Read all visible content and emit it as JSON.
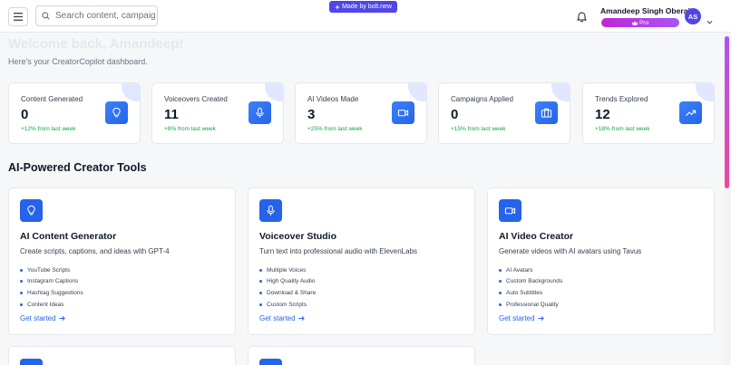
{
  "header": {
    "search_placeholder": "Search content, campaign",
    "bolt_badge": "Made by bolt.new",
    "user_name": "Amandeep Singh Oberai",
    "plan_badge": "Pro",
    "avatar_initials": "AS"
  },
  "welcome": {
    "title": "Welcome back, Amandeep!",
    "subtitle": "Here's your CreatorCopilot dashboard."
  },
  "stats": [
    {
      "title": "Content Generated",
      "value": "0",
      "change": "+12% from last week",
      "icon": "lightbulb-icon"
    },
    {
      "title": "Voiceovers Created",
      "value": "11",
      "change": "+8% from last week",
      "icon": "microphone-icon"
    },
    {
      "title": "AI Videos Made",
      "value": "3",
      "change": "+25% from last week",
      "icon": "video-icon"
    },
    {
      "title": "Campaigns Applied",
      "value": "0",
      "change": "+15% from last week",
      "icon": "briefcase-icon"
    },
    {
      "title": "Trends Explored",
      "value": "12",
      "change": "+18% from last week",
      "icon": "trending-up-icon"
    }
  ],
  "tools_section": {
    "title": "AI-Powered Creator Tools",
    "tools": [
      {
        "title": "AI Content Generator",
        "description": "Create scripts, captions, and ideas with GPT-4",
        "icon": "lightbulb-icon",
        "features": [
          "YouTube Scripts",
          "Instagram Captions",
          "Hashtag Suggestions",
          "Content Ideas"
        ],
        "link": "Get started"
      },
      {
        "title": "Voiceover Studio",
        "description": "Turn text into professional audio with ElevenLabs",
        "icon": "microphone-icon",
        "features": [
          "Multiple Voices",
          "High Quality Audio",
          "Download & Share",
          "Custom Scripts"
        ],
        "link": "Get started"
      },
      {
        "title": "AI Video Creator",
        "description": "Generate videos with AI avatars using Tavus",
        "icon": "video-icon",
        "features": [
          "AI Avatars",
          "Custom Backgrounds",
          "Auto Subtitles",
          "Professional Quality"
        ],
        "link": "Get started"
      }
    ]
  },
  "colors": {
    "accent": "#2563eb",
    "positive": "#16a34a",
    "bolt_badge": "#4f46e5",
    "pro_gradient": [
      "#c026d3",
      "#a855f7"
    ]
  }
}
